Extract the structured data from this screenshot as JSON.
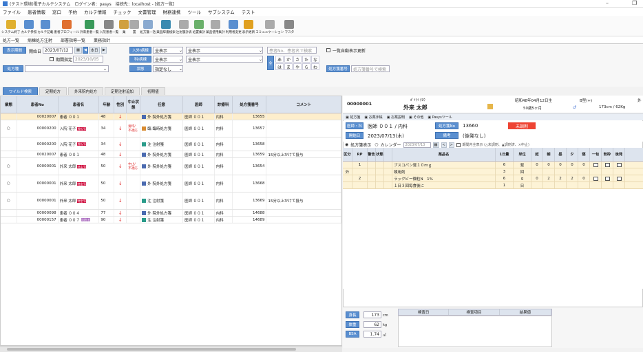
{
  "window": {
    "title": "(テスト環境)電子カルテシステム　ログイン者：pasys　接続先：localhost - [処方一覧]",
    "minimize": "–",
    "restore": "❐"
  },
  "menu": [
    "ファイル",
    "患者情報",
    "窓口",
    "予約",
    "カルテ情報",
    "チェック",
    "文書管理",
    "財務連携",
    "ツール",
    "サブシステム",
    "テスト"
  ],
  "toolbar": [
    {
      "label": "システム終了",
      "icon": "exit-icon",
      "color": "#e0b030"
    },
    {
      "label": "カルテ参照",
      "icon": "chart-view-icon",
      "color": "#5a8fd0"
    },
    {
      "label": "カルテ記載",
      "icon": "chart-write-icon",
      "color": "#5a8fd0"
    },
    {
      "label": "患者プロフィール",
      "icon": "profile-icon",
      "color": "#e07030"
    },
    {
      "label": "外来患者一覧",
      "icon": "outpatient-icon",
      "color": "#3a9a5a"
    },
    {
      "label": "入院患者一覧",
      "icon": "inpatient-icon",
      "color": "#888888"
    },
    {
      "label": "業",
      "icon": "work-icon",
      "color": "#d0a040"
    },
    {
      "label": "置",
      "icon": "placement-icon",
      "color": "#aaaaaa"
    },
    {
      "label": "処方箋一括",
      "icon": "prescription-icon",
      "color": "#8aaad0"
    },
    {
      "label": "薬品辞書検索",
      "icon": "drug-search-icon",
      "color": "#3a8ab0"
    },
    {
      "label": "注射箋計表",
      "icon": "injection-icon",
      "color": "#aaaaaa"
    },
    {
      "label": "処置集計",
      "icon": "treatment-icon",
      "color": "#6ab06a"
    },
    {
      "label": "薬品使用集計",
      "icon": "drug-usage-icon",
      "color": "#aaaaaa"
    },
    {
      "label": "利用者変更",
      "icon": "user-change-icon",
      "color": "#5a8fd0"
    },
    {
      "label": "表示更新",
      "icon": "refresh-icon",
      "color": "#e0a020"
    },
    {
      "label": "コミュニケーション",
      "icon": "communication-icon",
      "color": "#aaaaaa"
    },
    {
      "label": "マスタ",
      "icon": "master-gear-icon",
      "color": "#888888"
    }
  ],
  "subtabs": [
    "処方一覧",
    "病棟処方注射",
    "部署指導一覧",
    "業務指針"
  ],
  "filter": {
    "display_period_btn": "表示期間",
    "start_date_label": "開始日",
    "start_date": "2023/07/12",
    "today_btn": "本日",
    "end_check_label": "期間指定",
    "end_date": "2023/10/05",
    "inout_btn": "入外/病棟",
    "inout_val": "全表示",
    "dept_val": "全表示",
    "ward_btn": "科/病棟",
    "ward_val": "全表示",
    "ward_val2": "全表示",
    "rx_type_btn": "処方種",
    "status_btn": "状態",
    "status_val": "指定なし",
    "search_placeholder": "患者No、患者名で検索",
    "kana": [
      "あ",
      "か",
      "さ",
      "た",
      "な",
      "は",
      "ま",
      "や",
      "ら",
      "わ"
    ],
    "kana_all": "全",
    "batch_label": "一覧自動表示更新",
    "rxno_btn": "処方箋番号",
    "rxno_placeholder": "処方箋番号で検索"
  },
  "list_tabs": [
    "ワイルド検索",
    "定期処方",
    "外来院内処方",
    "定期注射追加",
    "初期値"
  ],
  "list_header": [
    "業態",
    "患者No",
    "患者名",
    "年齢",
    "性別",
    "中止状態",
    "任意",
    "医師",
    "診療科",
    "処方箋番号",
    "コメント"
  ],
  "list_rows": [
    {
      "mark": "",
      "no": "00020007",
      "name": "患者 ００１",
      "badge": "",
      "age": "48",
      "sex": "↓",
      "stop": "",
      "kind": "外 院外処方箋",
      "kicon": "b",
      "doctor": "医師 ００１",
      "dept": "内科",
      "rxno": "13655",
      "comment": "",
      "sel": true
    },
    {
      "mark": "○",
      "no": "00000200",
      "name": "入院 花子",
      "badge": "透析/同期/初見",
      "age": "34",
      "sex": "↓",
      "stop": "要印/不適応",
      "kind": "臨 臨時処方箋",
      "kicon": "o",
      "doctor": "医師 ００１",
      "dept": "内科",
      "rxno": "13657",
      "comment": "",
      "sel": false
    },
    {
      "mark": "",
      "no": "00000200",
      "name": "入院 花子",
      "badge": "透析/同期/初見",
      "age": "34",
      "sex": "↓",
      "stop": "",
      "kind": "注 注射箋",
      "kicon": "",
      "doctor": "医師 ００１",
      "dept": "内科",
      "rxno": "13658",
      "comment": "",
      "sel": false
    },
    {
      "mark": "",
      "no": "00020007",
      "name": "患者 ００１",
      "badge": "",
      "age": "48",
      "sex": "↓",
      "stop": "",
      "kind": "外 院外処方箋",
      "kicon": "b",
      "doctor": "医師 ００１",
      "dept": "内科",
      "rxno": "13659",
      "comment": "15分以上かけて投与",
      "sel": false
    },
    {
      "mark": "○",
      "no": "00000001",
      "name": "外来 太郎",
      "badge": "特定/同期/初見",
      "age": "50",
      "sex": "↓",
      "stop": "中止/不適応",
      "kind": "外 院外処方箋",
      "kicon": "b",
      "doctor": "医師 ００１",
      "dept": "内科",
      "rxno": "13654",
      "comment": "",
      "sel": false
    },
    {
      "mark": "○",
      "no": "00000001",
      "name": "外来 太郎",
      "badge": "特定/同期/初見",
      "age": "50",
      "sex": "↓",
      "stop": "",
      "kind": "外 院外処方箋",
      "kicon": "b",
      "doctor": "医師 ００１",
      "dept": "内科",
      "rxno": "13668",
      "comment": "",
      "sel": false
    },
    {
      "mark": "○",
      "no": "00000001",
      "name": "外来 太郎",
      "badge": "特定/同期/初見",
      "age": "50",
      "sex": "↓",
      "stop": "",
      "kind": "注 注射箋",
      "kicon": "",
      "doctor": "医師 ００１",
      "dept": "内科",
      "rxno": "13669",
      "comment": "15分以上かけて投与",
      "sel": false
    },
    {
      "mark": "",
      "no": "00000098",
      "name": "患者 ００４",
      "badge": "",
      "age": "77",
      "sex": "↓",
      "stop": "",
      "kind": "外 院外処方箋",
      "kicon": "b",
      "doctor": "医師 ００１",
      "dept": "内科",
      "rxno": "14688",
      "comment": "",
      "sel": false
    },
    {
      "mark": "",
      "no": "00000157",
      "name": "患者 ００７",
      "badge": "同期/初見",
      "age": "90",
      "sex": "↓",
      "stop": "",
      "kind": "注 注射箋",
      "kicon": "",
      "doctor": "医師 ００１",
      "dept": "内科",
      "rxno": "14689",
      "comment": "",
      "sel": false
    }
  ],
  "patient": {
    "id": "00000001",
    "kana": "ｶﾞｲﾗｲ ﾀﾛｳ",
    "name": "外来 太郎",
    "birth": "昭和48年04月12日生",
    "age": "50歳5ヶ月",
    "blood": "B型(+)",
    "hw": "173cm / 62Kg",
    "outpatient": "外"
  },
  "right_toolbar": [
    "処方箋",
    "お薬手帳",
    "お薬説明",
    "その他",
    "Pasysツール"
  ],
  "rx_detail": {
    "doctor_btn": "医師・科",
    "doctor": "医師 ００１ / 内科",
    "rxno_btn": "処方箋No",
    "rxno": "13660",
    "status": "未調剤",
    "start_btn": "開始日",
    "start_date": "2023/07/13(木)",
    "note_btn": "備考",
    "note": "(後発なし)",
    "radio1": "処方箋表示",
    "radio2": "カレンダー",
    "cal_date": "2023/07/13",
    "legend": "期間内全表示 (△未調剤、▲調剤済、×中止)"
  },
  "rx_header": [
    "区分",
    "RP",
    "警告",
    "状態",
    "",
    "薬品名",
    "1日量",
    "単位",
    "起",
    "朝",
    "昼",
    "夕",
    "寝",
    "一包",
    "粉砕",
    "後発"
  ],
  "rx_rows": [
    {
      "kubun": "",
      "rp": "1",
      "drug": "ブスコパン錠１０ｍｇ",
      "qty": "6",
      "unit": "錠",
      "v": [
        "0",
        "0",
        "0",
        "0",
        "0"
      ]
    },
    {
      "kubun": "外",
      "rp": "",
      "drug": "頓用剤",
      "qty": "3",
      "unit": "回",
      "v": [
        "",
        "",
        "",
        "",
        ""
      ]
    },
    {
      "kubun": "",
      "rp": "2",
      "drug": "ラックビー微粒N　1%",
      "qty": "6",
      "unit": "g",
      "v": [
        "0",
        "2",
        "2",
        "2",
        "0"
      ]
    },
    {
      "kubun": "",
      "rp": "",
      "drug": "１日３回毎食後に",
      "qty": "1",
      "unit": "日",
      "v": [
        "",
        "",
        "",
        "",
        ""
      ]
    }
  ],
  "vitals": {
    "height_btn": "身長",
    "height": "173",
    "height_unit": "cm",
    "weight_btn": "体重",
    "weight": "62",
    "weight_unit": "kg",
    "bsa_btn": "BSA",
    "bsa": "1.74",
    "bsa_unit": "㎡"
  },
  "lab_header": [
    "検査日",
    "検査項目",
    "結果値"
  ]
}
